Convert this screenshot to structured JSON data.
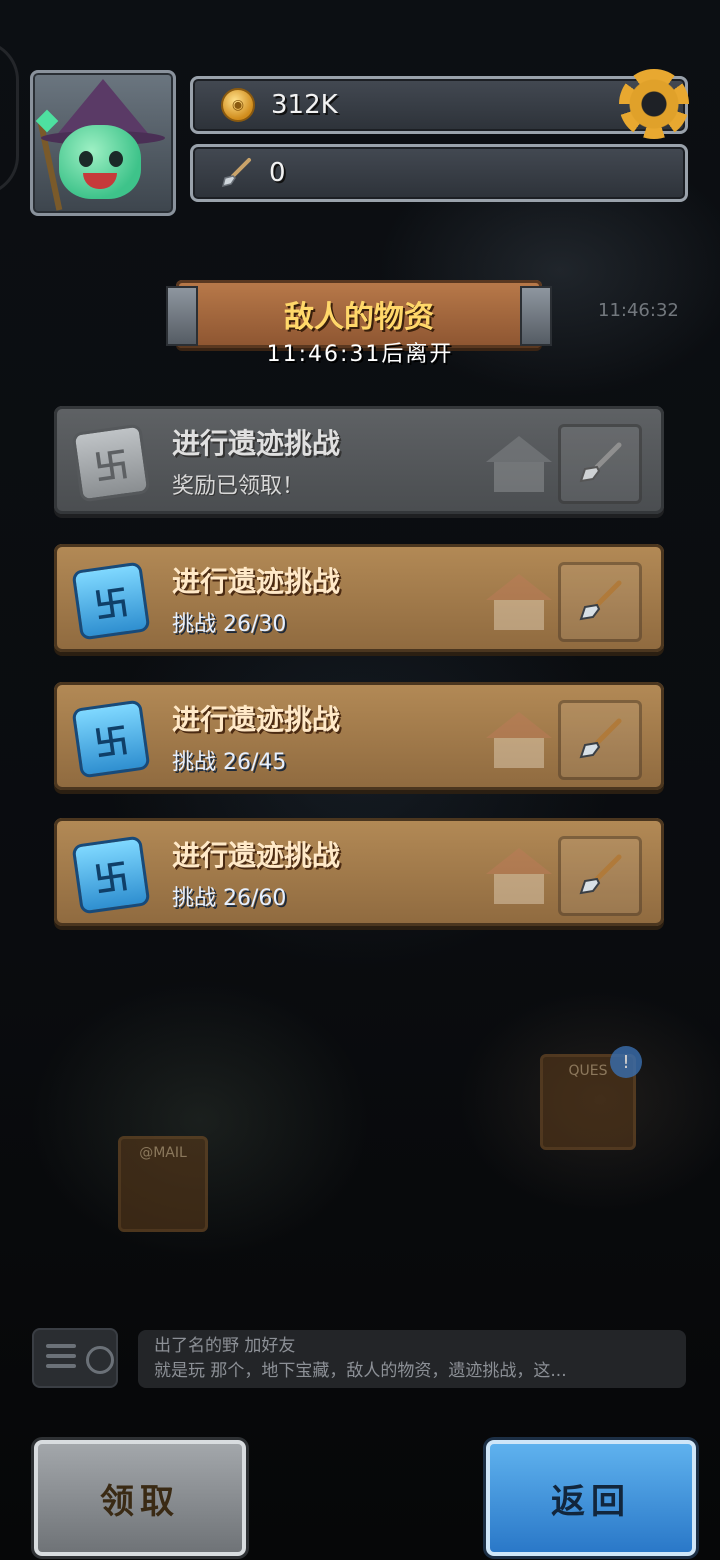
{
  "header": {
    "gold_amount": "312K",
    "shovel_count": "0"
  },
  "event": {
    "title": "敌人的物资",
    "timer": "11:46:31后离开",
    "map_timer": "11:46:32"
  },
  "challenges": [
    {
      "title": "进行遗迹挑战",
      "subtitle": "奖励已领取！",
      "state": "claimed"
    },
    {
      "title": "进行遗迹挑战",
      "subtitle": "挑战 26/30",
      "progress": 26,
      "target": 30,
      "state": "active"
    },
    {
      "title": "进行遗迹挑战",
      "subtitle": "挑战 26/45",
      "progress": 26,
      "target": 45,
      "state": "active"
    },
    {
      "title": "进行遗迹挑战",
      "subtitle": "挑战 26/60",
      "progress": 26,
      "target": 60,
      "state": "active"
    }
  ],
  "map_labels": {
    "mail": "@MAIL",
    "quest": "QUES"
  },
  "chat": {
    "line1": "出了名的野  加好友",
    "line2": "就是玩  那个，地下宝藏，敌人的物资，遗迹挑战，这..."
  },
  "buttons": {
    "claim": "领取",
    "back": "返回"
  },
  "colors": {
    "banner_text": "#ffd86a",
    "card_active": "#b38a56",
    "card_claimed": "#5f6265",
    "back_button": "#3a90dc"
  }
}
